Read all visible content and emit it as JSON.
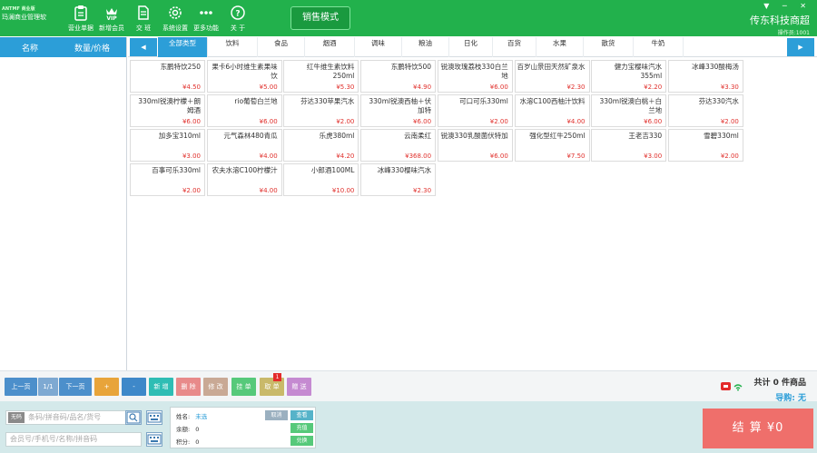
{
  "app": {
    "title": "玛澜商业管理软",
    "title_line2": "软",
    "logo_mark": "ANTMF 商业版",
    "mode_label": "销售模式",
    "store_name": "传东科技商超",
    "operator": "操作员:1001",
    "window_controls": "▼ ─ ✕"
  },
  "toolbar": [
    {
      "label": "营业单据",
      "icon": "clipboard-icon"
    },
    {
      "label": "新增会员",
      "icon": "vip-icon"
    },
    {
      "label": "交 班",
      "icon": "document-icon"
    },
    {
      "label": "系统设置",
      "icon": "gear-icon"
    },
    {
      "label": "更多功能",
      "icon": "more-icon"
    },
    {
      "label": "关 于",
      "icon": "help-icon"
    }
  ],
  "cart": {
    "col_name": "名称",
    "col_qty_price": "数量/价格"
  },
  "categories": [
    {
      "label": "全部类型",
      "active": true
    },
    {
      "label": "饮料"
    },
    {
      "label": "食品"
    },
    {
      "label": "烟酒"
    },
    {
      "label": "调味"
    },
    {
      "label": "粮油"
    },
    {
      "label": "日化"
    },
    {
      "label": "百货"
    },
    {
      "label": "水果"
    },
    {
      "label": "散货"
    },
    {
      "label": "牛奶"
    }
  ],
  "products": [
    {
      "name": "东鹏特饮250",
      "price": "¥4.50"
    },
    {
      "name": "果卡6小时维生素果味饮",
      "price": "¥5.00"
    },
    {
      "name": "红牛维生素饮料250ml",
      "price": "¥5.30"
    },
    {
      "name": "东鹏特饮500",
      "price": "¥4.90"
    },
    {
      "name": "锐澳玫瑰荔枝330白兰地",
      "price": "¥6.00"
    },
    {
      "name": "百岁山景田天然矿泉水",
      "price": "¥2.30"
    },
    {
      "name": "健力宝樱味汽水355ml",
      "price": "¥2.20"
    },
    {
      "name": "冰峰330酸梅汤",
      "price": "¥3.30"
    },
    {
      "name": "330ml锐澳柠檬＋朗姆酒",
      "price": "¥6.00"
    },
    {
      "name": "rio葡萄白兰地",
      "price": "¥6.00"
    },
    {
      "name": "芬达330苹果汽水",
      "price": "¥2.00"
    },
    {
      "name": "330ml锐澳西柚＋伏加特",
      "price": "¥6.00"
    },
    {
      "name": "可口可乐330ml",
      "price": "¥2.00"
    },
    {
      "name": "水溶C100西柚汁饮料",
      "price": "¥4.00"
    },
    {
      "name": "330ml锐澳白桃＋白兰地",
      "price": "¥6.00"
    },
    {
      "name": "芬达330汽水",
      "price": "¥2.00"
    },
    {
      "name": "加多宝310ml",
      "price": "¥3.00"
    },
    {
      "name": "元气森林480青瓜",
      "price": "¥4.00"
    },
    {
      "name": "乐虎380ml",
      "price": "¥4.20"
    },
    {
      "name": "云南柔红",
      "price": "¥368.00"
    },
    {
      "name": "锐澳330乳酸菌伏特加",
      "price": "¥6.00"
    },
    {
      "name": "强化型红牛250ml",
      "price": "¥7.50"
    },
    {
      "name": "王老吉330",
      "price": "¥3.00"
    },
    {
      "name": "雪碧330ml",
      "price": "¥2.00"
    },
    {
      "name": "百事可乐330ml",
      "price": "¥2.00"
    },
    {
      "name": "农夫水溶C100柠檬汁",
      "price": "¥4.00"
    },
    {
      "name": "小郎酒100ML",
      "price": "¥10.00"
    },
    {
      "name": "冰峰330樱味汽水",
      "price": "¥2.30"
    }
  ],
  "pager": {
    "prev": "上一页",
    "page": "1/1",
    "next": "下一页"
  },
  "actions": [
    {
      "label": "+",
      "color": "#e8a43a"
    },
    {
      "label": "-",
      "color": "#3e88c9"
    },
    {
      "label": "新 增",
      "color": "#2fbdb4"
    },
    {
      "label": "删 除",
      "color": "#e88a8a"
    },
    {
      "label": "修 改",
      "color": "#c9a995"
    },
    {
      "label": "挂 单",
      "color": "#56c97a"
    },
    {
      "label": "取 单",
      "color": "#c9b96a"
    },
    {
      "label": "赠 送",
      "color": "#c58ad1"
    }
  ],
  "pending_count": "1",
  "summary": {
    "total": "共计 0 件商品",
    "guide": "导购: 无"
  },
  "footer": {
    "scan_tag": "无码",
    "scan_placeholder": "条码/拼音码/品名/货号",
    "member_placeholder": "会员号/手机号/名称/拼音码",
    "name_label": "姓名:",
    "name_value": "未选",
    "balance_label": "余额:",
    "balance_value": "0",
    "points_label": "积分:",
    "points_value": "0",
    "cancel_btn": "取消",
    "view_btn": "查看",
    "recharge_btn": "充值",
    "redeem_btn": "兑换",
    "checkout": "结 算 ¥0"
  }
}
